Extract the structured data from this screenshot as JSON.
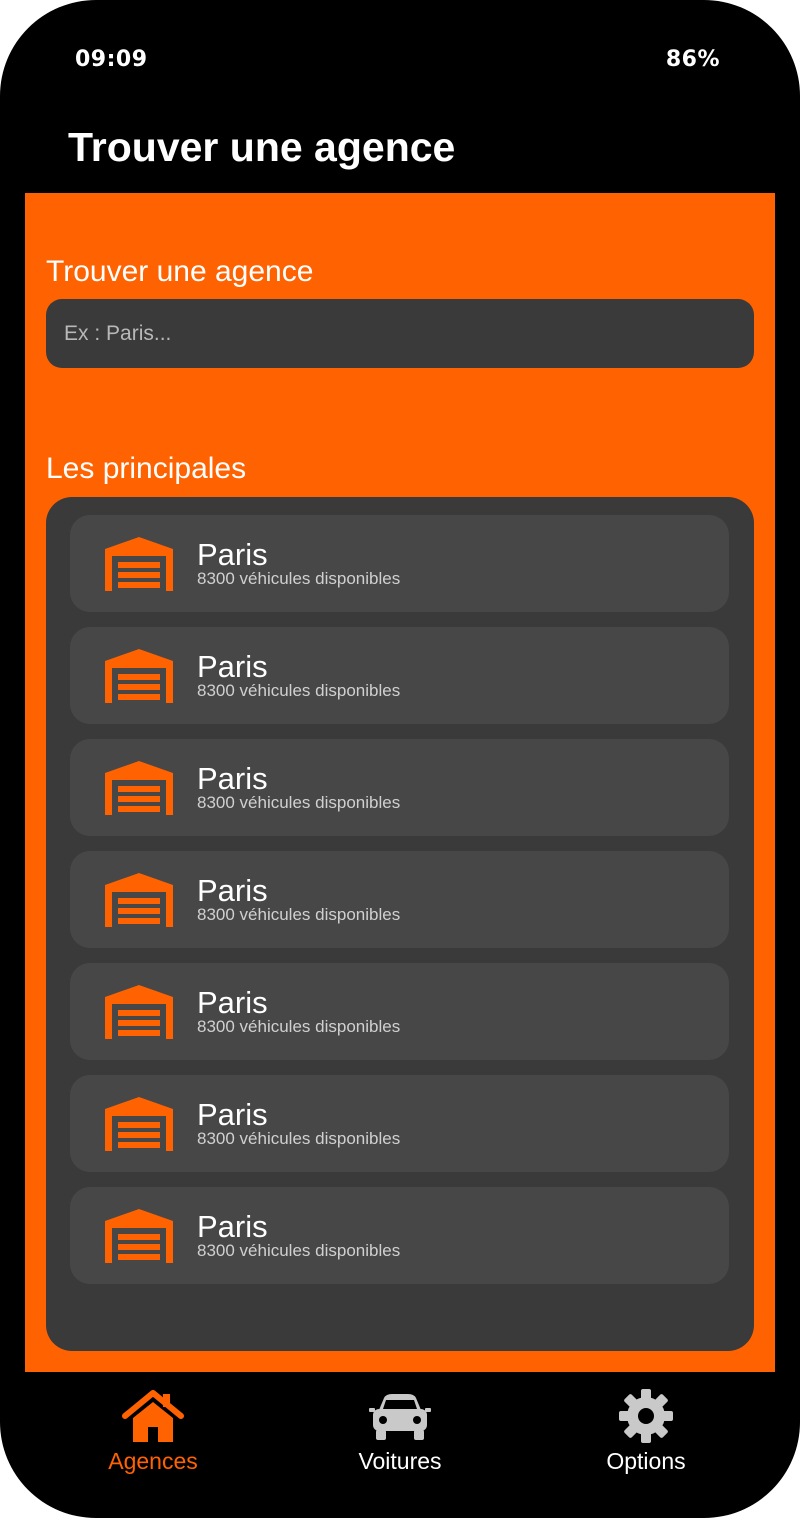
{
  "status_bar": {
    "time": "09:09",
    "battery": "86%"
  },
  "header": {
    "title": "Trouver une agence"
  },
  "search": {
    "label": "Trouver une agence",
    "placeholder": "Ex : Paris...",
    "value": ""
  },
  "main": {
    "section_label": "Les principales",
    "agencies": [
      {
        "name": "Paris",
        "subtitle": "8300 véhicules disponibles",
        "icon": "garage-icon"
      },
      {
        "name": "Paris",
        "subtitle": "8300 véhicules disponibles",
        "icon": "garage-icon"
      },
      {
        "name": "Paris",
        "subtitle": "8300 véhicules disponibles",
        "icon": "garage-icon"
      },
      {
        "name": "Paris",
        "subtitle": "8300 véhicules disponibles",
        "icon": "garage-icon"
      },
      {
        "name": "Paris",
        "subtitle": "8300 véhicules disponibles",
        "icon": "garage-icon"
      },
      {
        "name": "Paris",
        "subtitle": "8300 véhicules disponibles",
        "icon": "garage-icon"
      },
      {
        "name": "Paris",
        "subtitle": "8300 véhicules disponibles",
        "icon": "garage-icon"
      }
    ]
  },
  "nav": {
    "items": [
      {
        "label": "Agences",
        "icon": "home-icon",
        "active": true
      },
      {
        "label": "Voitures",
        "icon": "car-icon",
        "active": false
      },
      {
        "label": "Options",
        "icon": "gear-icon",
        "active": false
      }
    ]
  },
  "colors": {
    "accent": "#ff6200",
    "background": "#000000",
    "panel": "#3a3a3a",
    "card": "#474747",
    "nav_inactive_icon": "#c9c9c9"
  }
}
